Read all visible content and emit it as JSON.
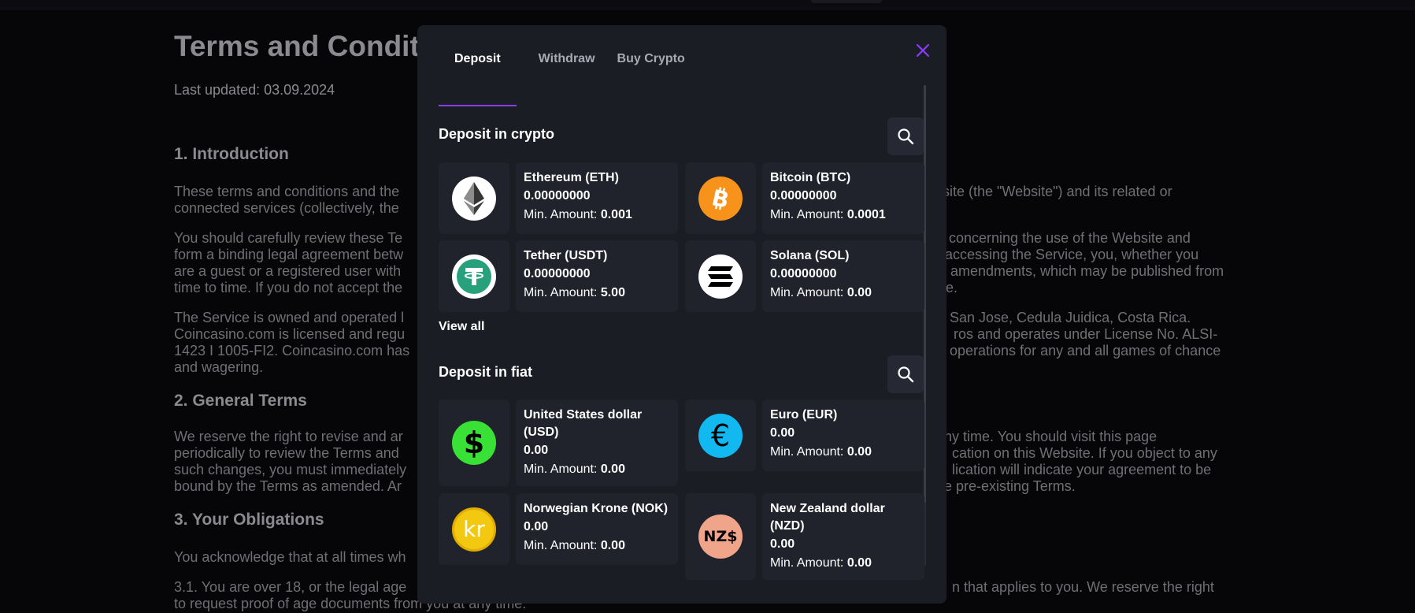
{
  "background_page": {
    "title": "Terms and Condit",
    "updated": "Last updated: 03.09.2024",
    "h_intro": "1. Introduction",
    "intro_l1a": "These terms and conditions and the",
    "intro_l1b": "site (the \"Website\") and its related or",
    "intro_l2a": "connected services (collectively, the",
    "p2_l1a": "You should carefully review these Te",
    "p2_l1b": "ns concerning the use of the Website and",
    "p2_l2a": "form a binding legal agreement betw",
    "p2_l2b": "r accessing the Service, you, whether you",
    "p2_l3a": "are a guest or a registered user with",
    "p2_l3b": "amendments, which may be published from",
    "p2_l4a": "time to time. If you do not accept the",
    "p2_l4b": "e.",
    "p3_l1a": "The Service is owned and operated l",
    "p3_l1b": "San Jose, Cedula Juidica, Costa Rica.",
    "p3_l2a": "Coincasino.com is licensed and regu",
    "p3_l2b": "ros and operates under License No. ALSI-",
    "p3_l3a": "1423 I 1005-FI2. Coincasino.com has",
    "p3_l3b": "operations for any and all games of chance",
    "p3_l4a": "and wagering.",
    "h_general": "2. General Terms",
    "p4_l1a": "We reserve the right to revise and ar",
    "p4_l1b": "ny time. You should visit this page",
    "p4_l2a": "periodically to review the Terms and",
    "p4_l2b": "cation on this Website. If you object to any",
    "p4_l3a": "such changes, you must immediately",
    "p4_l3b": "lication will indicate your agreement to be",
    "p4_l4a": "bound by the Terms as amended. Ar",
    "p4_l4b": "e pre-existing Terms.",
    "h_obligations": "3. Your Obligations",
    "p5_l1a": "You acknowledge that at all times wh",
    "p6_l1a": "3.1. You are over 18, or the legal age",
    "p6_l1b": "n that applies to you. We reserve the right",
    "p6_l2a": "to request proof of age documents from you at any time."
  },
  "modal": {
    "tabs": [
      "Deposit",
      "Withdraw",
      "Buy Crypto"
    ],
    "active_tab": "Deposit",
    "crypto_title": "Deposit in crypto",
    "fiat_title": "Deposit in fiat",
    "view_all": "View all",
    "crypto": [
      {
        "name": "Ethereum (ETH)",
        "balance": "0.00000000",
        "min_label": "Min. Amount:",
        "min": "0.001",
        "icon": "ethereum-icon"
      },
      {
        "name": "Bitcoin (BTC)",
        "balance": "0.00000000",
        "min_label": "Min. Amount:",
        "min": "0.0001",
        "icon": "bitcoin-icon"
      },
      {
        "name": "Tether (USDT)",
        "balance": "0.00000000",
        "min_label": "Min. Amount:",
        "min": "5.00",
        "icon": "tether-icon"
      },
      {
        "name": "Solana (SOL)",
        "balance": "0.00000000",
        "min_label": "Min. Amount:",
        "min": "0.00",
        "icon": "solana-icon"
      }
    ],
    "fiat": [
      {
        "name": "United States dollar (USD)",
        "balance": "0.00",
        "min_label": "Min. Amount:",
        "min": "0.00",
        "icon": "dollar-icon",
        "glyph": "$"
      },
      {
        "name": "Euro (EUR)",
        "balance": "0.00",
        "min_label": "Min. Amount:",
        "min": "0.00",
        "icon": "euro-icon",
        "glyph": "€"
      },
      {
        "name": "Norwegian Krone (NOK)",
        "balance": "0.00",
        "min_label": "Min. Amount:",
        "min": "0.00",
        "icon": "krone-icon",
        "glyph": "kr"
      },
      {
        "name": "New Zealand dollar (NZD)",
        "balance": "0.00",
        "min_label": "Min. Amount:",
        "min": "0.00",
        "icon": "nzd-icon",
        "glyph": "NZ$"
      }
    ]
  },
  "colors": {
    "accent": "#8b3dff",
    "modal_bg": "#1b1d24",
    "card_bg": "#20232b",
    "bitcoin": "#f7931a",
    "tether": "#26a17b",
    "dollar": "#39e035",
    "euro": "#12b8f0",
    "krone": "#f2c811",
    "nzd": "#f0a48a"
  }
}
